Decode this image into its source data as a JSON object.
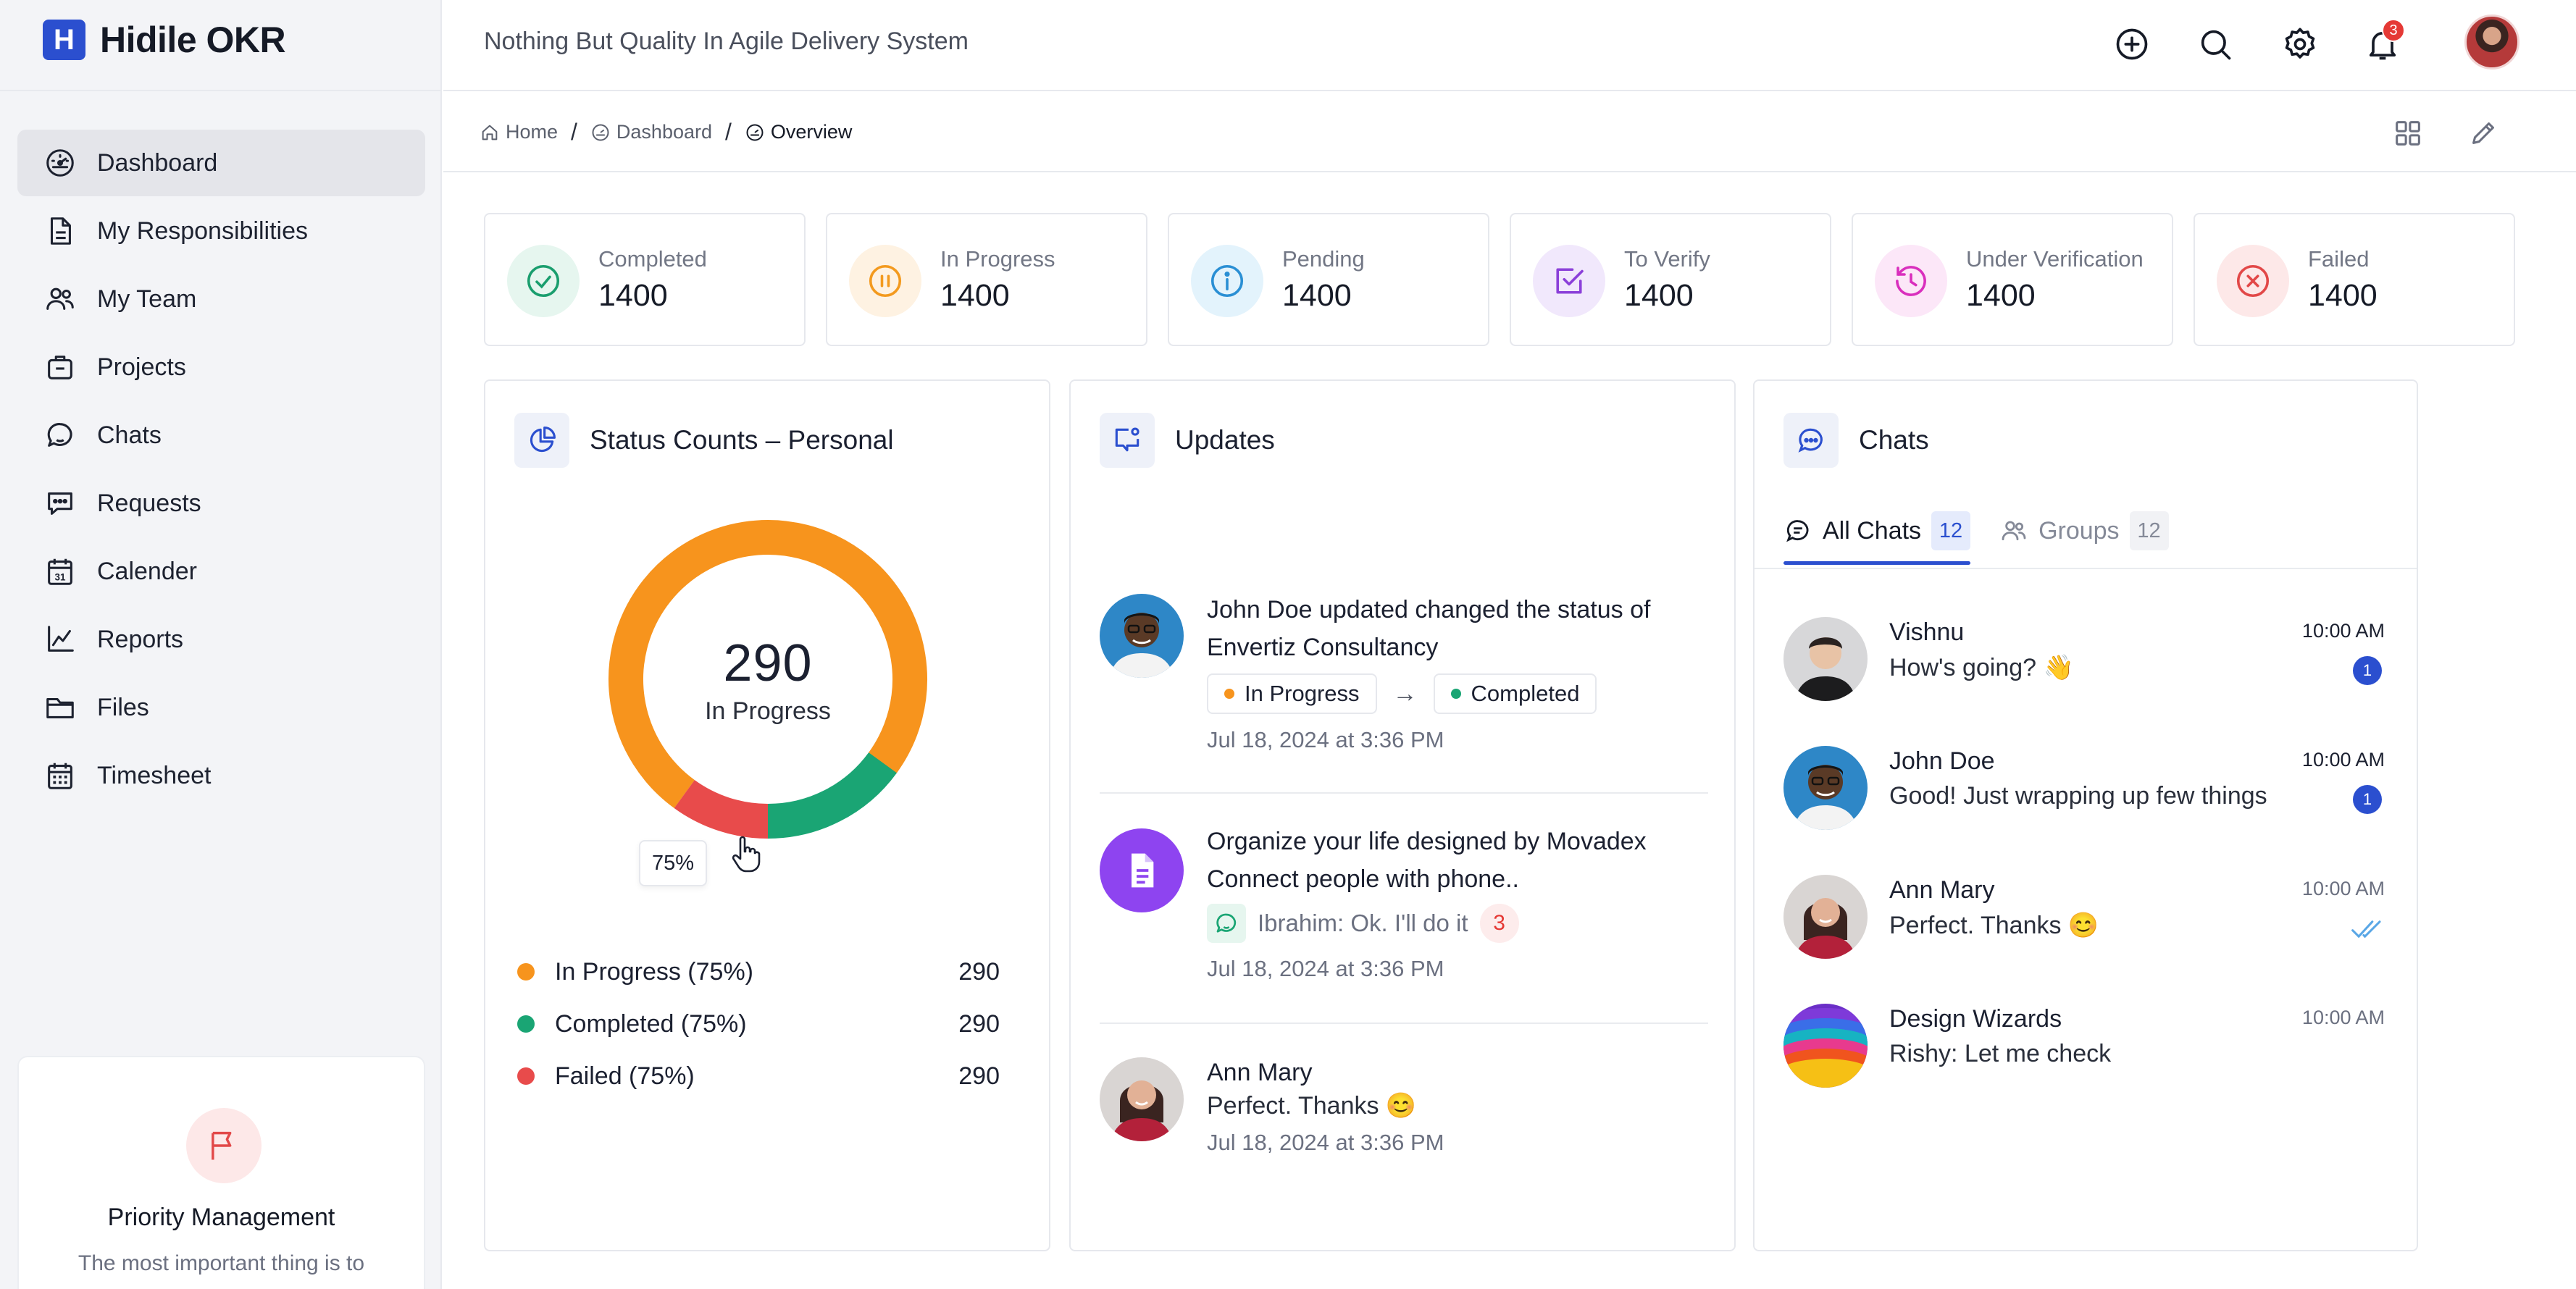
{
  "app": {
    "name": "Hidile OKR",
    "logo_letter": "H",
    "tagline": "Nothing But Quality In Agile Delivery System",
    "accent": "#2b4fcf"
  },
  "sidebar": {
    "items": [
      {
        "label": "Dashboard",
        "icon": "dashboard-gauge-icon",
        "active": true
      },
      {
        "label": "My Responsibilities",
        "icon": "document-icon"
      },
      {
        "label": "My Team",
        "icon": "team-icon"
      },
      {
        "label": "Projects",
        "icon": "briefcase-icon"
      },
      {
        "label": "Chats",
        "icon": "chat-bubble-icon"
      },
      {
        "label": "Requests",
        "icon": "message-dots-icon"
      },
      {
        "label": "Calender",
        "icon": "calendar-icon"
      },
      {
        "label": "Reports",
        "icon": "chart-line-icon"
      },
      {
        "label": "Files",
        "icon": "folder-icon"
      },
      {
        "label": "Timesheet",
        "icon": "timesheet-icon"
      }
    ],
    "promo": {
      "icon": "flag-icon",
      "title": "Priority Management",
      "text": "The most important thing is to"
    }
  },
  "topbar": {
    "icons": [
      "add-icon",
      "search-icon",
      "settings-icon",
      "notification-bell-icon"
    ],
    "notification_count": "3"
  },
  "breadcrumb": {
    "items": [
      "Home",
      "Dashboard",
      "Overview"
    ],
    "separator": "/"
  },
  "stats": [
    {
      "label": "Completed",
      "value": "1400",
      "color": "#1a9e6e",
      "bg": "#e6f6ef"
    },
    {
      "label": "In Progress",
      "value": "1400",
      "color": "#f39a1e",
      "bg": "#fef2e2"
    },
    {
      "label": "Pending",
      "value": "1400",
      "color": "#2a8fd4",
      "bg": "#e3f3fc"
    },
    {
      "label": "To Verify",
      "value": "1400",
      "color": "#8b3fd9",
      "bg": "#f1e8fc"
    },
    {
      "label": "Under Verification",
      "value": "1400",
      "color": "#d92fbd",
      "bg": "#fce7f8"
    },
    {
      "label": "Failed",
      "value": "1400",
      "color": "#e24848",
      "bg": "#fde8e8"
    }
  ],
  "status_panel": {
    "title": "Status Counts – Personal",
    "center_value": "290",
    "center_label": "In Progress",
    "tooltip": "75%",
    "legend": [
      {
        "label": "In Progress (75%)",
        "value": "290",
        "color": "#f7941d"
      },
      {
        "label": "Completed (75%)",
        "value": "290",
        "color": "#1aa574"
      },
      {
        "label": "Failed (75%)",
        "value": "290",
        "color": "#e84b4b"
      }
    ]
  },
  "chart_data": {
    "type": "pie",
    "title": "Status Counts – Personal",
    "slices": [
      {
        "label": "In Progress",
        "share": 0.75,
        "color": "#f7941d"
      },
      {
        "label": "Completed",
        "share": 0.15,
        "color": "#1aa574"
      },
      {
        "label": "Failed",
        "share": 0.1,
        "color": "#e84b4b"
      }
    ]
  },
  "updates_panel": {
    "title": "Updates",
    "items": [
      {
        "title_line1": "John  Doe updated changed the status of",
        "title_line2": "Envertiz Consultancy",
        "from_status": "In Progress",
        "from_color": "#f7941d",
        "arrow": "→",
        "to_status": "Completed",
        "to_color": "#1aa574",
        "date": "Jul 18, 2024 at 3:36 PM"
      },
      {
        "title_line1": "Organize your life designed by Movadex",
        "title_line2": "Connect people with phone..",
        "comment": "Ibrahim: Ok. I'll do it",
        "comment_count": "3",
        "date": "Jul 18, 2024 at 3:36 PM"
      },
      {
        "name": "Ann Mary",
        "message": "Perfect. Thanks 😊",
        "date": "Jul 18, 2024 at 3:36 PM"
      }
    ]
  },
  "chats_panel": {
    "title": "Chats",
    "tabs": [
      {
        "label": "All Chats",
        "count": "12",
        "active": true
      },
      {
        "label": "Groups",
        "count": "12"
      }
    ],
    "items": [
      {
        "name": "Vishnu",
        "message": "How's going? 👋",
        "time": "10:00 AM",
        "unread": "1"
      },
      {
        "name": "John Doe",
        "message": "Good! Just wrapping up few things",
        "time": "10:00 AM",
        "unread": "1"
      },
      {
        "name": "Ann Mary",
        "message": "Perfect. Thanks 😊",
        "time": "10:00 AM",
        "read": true
      },
      {
        "name": "Design Wizards",
        "message": "Rishy: Let me check",
        "time": "10:00 AM"
      }
    ]
  }
}
